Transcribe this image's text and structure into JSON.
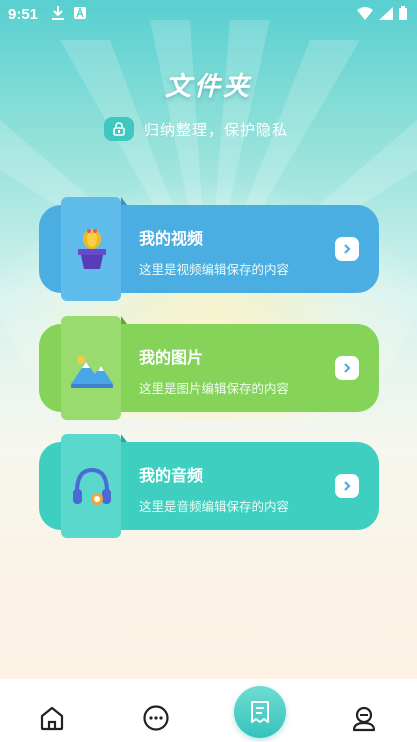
{
  "status_bar": {
    "time": "9:51"
  },
  "header": {
    "title": "文件夹",
    "subtitle": "归纳整理，保护隐私"
  },
  "cards": [
    {
      "title": "我的视频",
      "description": "这里是视频编辑保存的内容",
      "color": "#4aaee2",
      "tab_color": "#5fbbea",
      "icon": "cactus-pot-icon"
    },
    {
      "title": "我的图片",
      "description": "这里是图片编辑保存的内容",
      "color": "#86d35a",
      "tab_color": "#99dc6d",
      "icon": "mountain-picture-icon"
    },
    {
      "title": "我的音频",
      "description": "这里是音频编辑保存的内容",
      "color": "#3fcfc1",
      "tab_color": "#5ad8cc",
      "icon": "headphones-icon"
    }
  ],
  "bottom_nav": {
    "items": [
      "home-icon",
      "chat-bubble-icon",
      "folder-document-icon",
      "profile-icon"
    ],
    "active": "folder-document-icon"
  }
}
